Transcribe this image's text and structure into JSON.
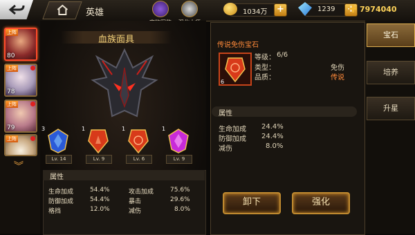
{
  "header": {
    "title": "英雄",
    "shortcuts": [
      {
        "label": "宝物图鉴",
        "icon": "treasure-book-icon"
      },
      {
        "label": "强化大师",
        "icon": "enhance-master-icon"
      }
    ],
    "gold": "1034万",
    "gems": "1239",
    "power": "7974040"
  },
  "heroes": [
    {
      "level": "80",
      "tag": "上阵",
      "selected": true
    },
    {
      "level": "78",
      "tag": "上阵",
      "badge": true
    },
    {
      "level": "79",
      "tag": "上阵",
      "badge": true
    },
    {
      "level": "",
      "tag": "上阵",
      "badge": true
    }
  ],
  "equipment": {
    "name": "血族面具",
    "slots": [
      {
        "count": "3",
        "level": "Lv. 14",
        "color": "#2a5ad8"
      },
      {
        "count": "1",
        "level": "Lv. 9",
        "color": "#d83a1a"
      },
      {
        "count": "1",
        "level": "Lv. 6",
        "color": "#d83a1a"
      },
      {
        "count": "1",
        "level": "Lv. 9",
        "color": "#c82ad8"
      }
    ],
    "attr_title": "属性",
    "attrs": [
      {
        "name": "生命加成",
        "value": "54.4%"
      },
      {
        "name": "攻击加成",
        "value": "75.6%"
      },
      {
        "name": "防御加成",
        "value": "54.4%"
      },
      {
        "name": "暴击",
        "value": "29.6%"
      },
      {
        "name": "格挡",
        "value": "12.0%"
      },
      {
        "name": "减伤",
        "value": "8.0%"
      }
    ]
  },
  "detail": {
    "title": "传说免伤宝石",
    "count": "6",
    "level_label": "等级：",
    "level_value": "6/6",
    "type_label": "类型：",
    "type_value": "免伤",
    "quality_label": "品质：",
    "quality_value": "传说",
    "attr_title": "属性",
    "attrs": [
      {
        "name": "生命加成",
        "value": "24.4%"
      },
      {
        "name": "防御加成",
        "value": "24.4%"
      },
      {
        "name": "减伤",
        "value": "8.0%"
      }
    ],
    "unequip_label": "卸下",
    "enhance_label": "强化"
  },
  "tabs": [
    {
      "label": "宝石",
      "active": true
    },
    {
      "label": "培养",
      "active": false
    },
    {
      "label": "升星",
      "active": false
    }
  ],
  "colors": {
    "accent": "#c08a30",
    "legend": "#ff8a3a",
    "gold": "#ffd45a"
  }
}
